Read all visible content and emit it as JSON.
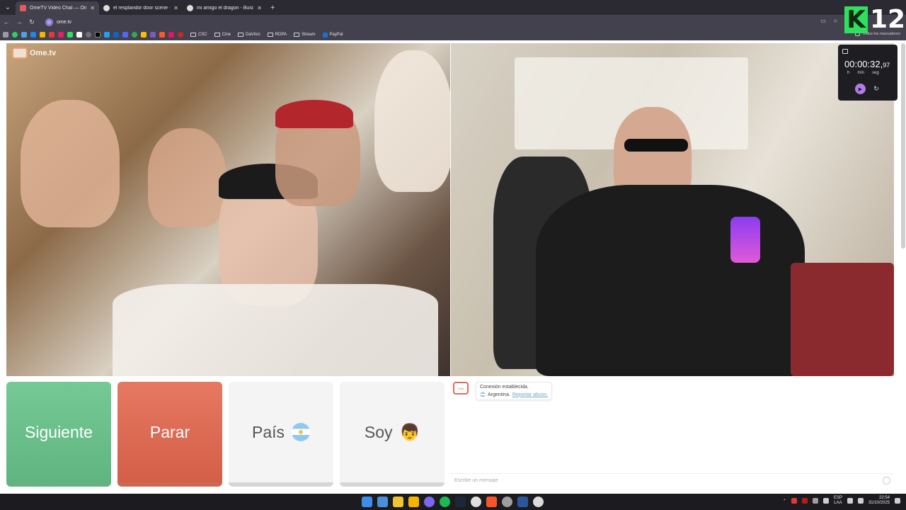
{
  "browser": {
    "tabs": [
      {
        "title": "OmeTV Video Chat — Ome",
        "active": true,
        "favicon_color": "#e35b5b"
      },
      {
        "title": "el resplandor door scene - Bus",
        "active": false,
        "favicon_color": "#dddddd"
      },
      {
        "title": "mi amigo el dragon - Buscar c",
        "active": false,
        "favicon_color": "#dddddd"
      }
    ],
    "new_tab": "+",
    "url": "ome.tv",
    "bookmark_folders": [
      "CSC",
      "Cine",
      "DaVinci",
      "ROPA",
      "Stream"
    ],
    "paypal_label": "PayPal",
    "all_bookmarks": "Todos los marcadores"
  },
  "overlay_logo": {
    "letter": "K",
    "number": "12"
  },
  "page": {
    "brand": "Ome.tv",
    "timer": {
      "main": "00:00:32,",
      "fraction": "97",
      "units": [
        "h",
        "min",
        "seg"
      ]
    },
    "buttons": {
      "next": "Siguiente",
      "stop": "Parar",
      "country": "País",
      "me": "Soy"
    },
    "me_emoji": "👦",
    "chat": {
      "status": "Conexión establecida.",
      "country": "Argentina.",
      "report": "Reportar abuso.",
      "placeholder": "Escribe un mensaje"
    }
  },
  "taskbar": {
    "lang_top": "ESP",
    "lang_bottom": "LAA",
    "time": "22:54",
    "date": "31/10/2025"
  }
}
